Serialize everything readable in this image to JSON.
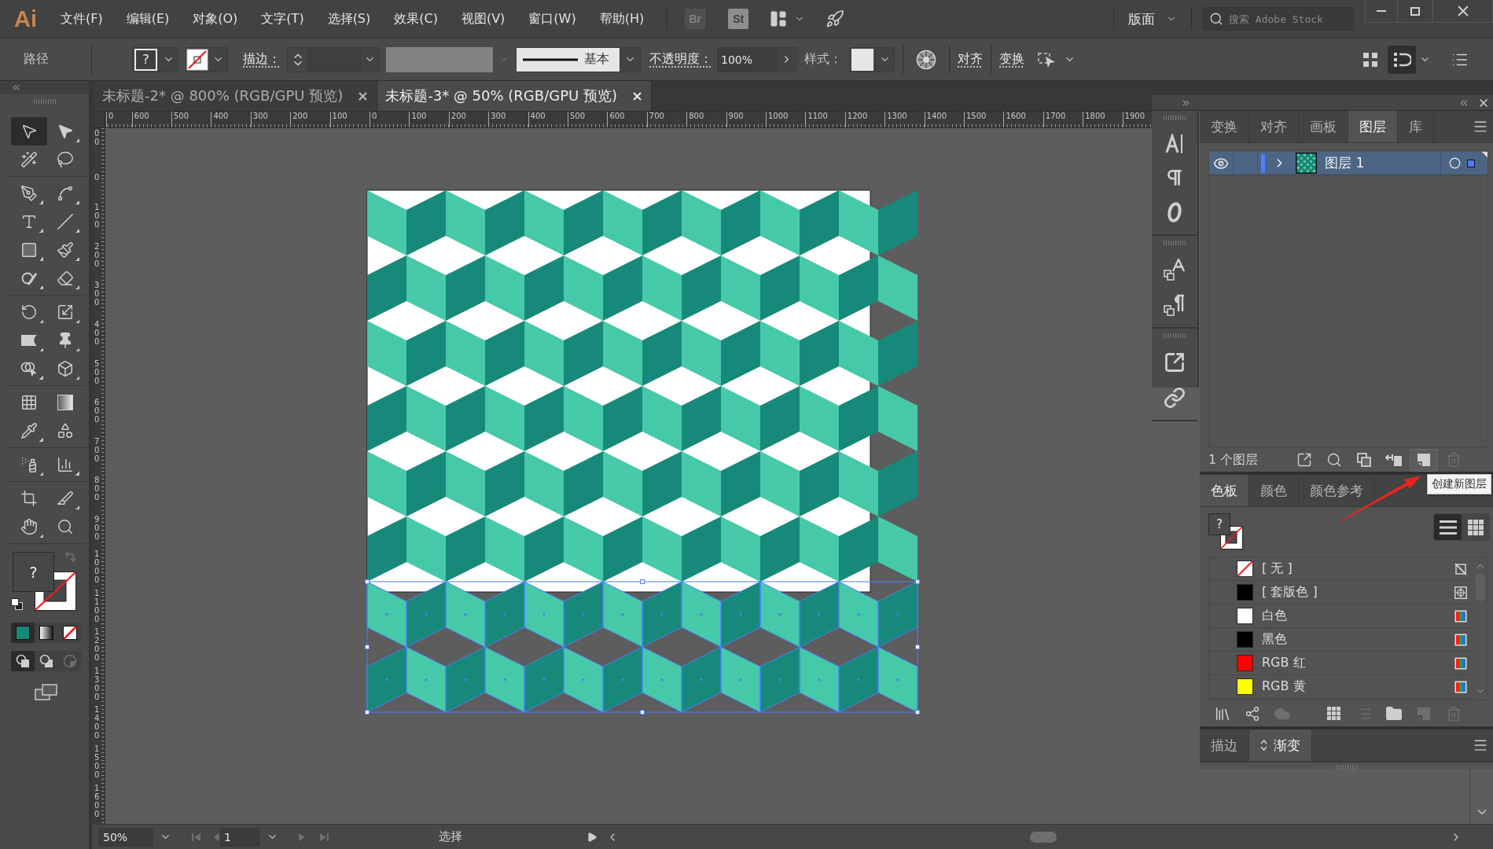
{
  "menu_bar": {
    "logo": "Ai",
    "items": [
      "文件(F)",
      "编辑(E)",
      "对象(O)",
      "文字(T)",
      "选择(S)",
      "效果(C)",
      "视图(V)",
      "窗口(W)",
      "帮助(H)"
    ],
    "bridge": "Br",
    "stock": "St",
    "workspace": "版面",
    "search": {
      "placeholder": "搜索 Adobe Stock"
    }
  },
  "control_bar": {
    "selection": "路径",
    "fill": "?",
    "stroke_label": "描边：",
    "brush": "基本",
    "opacity_label": "不透明度：",
    "opacity": "100%",
    "style_label": "样式：",
    "align": "对齐",
    "transform": "变换"
  },
  "toolbar": {
    "tool_groups": [
      [
        {
          "kind": "selection",
          "selected": true,
          "flyout": false
        },
        {
          "kind": "direct-selection",
          "selected": false,
          "flyout": true
        },
        {
          "kind": "magic-wand",
          "selected": false,
          "flyout": false
        },
        {
          "kind": "lasso",
          "selected": false,
          "flyout": false
        }
      ],
      [
        {
          "kind": "pen",
          "selected": false,
          "flyout": true
        },
        {
          "kind": "curvature",
          "selected": false,
          "flyout": true
        },
        {
          "kind": "type",
          "selected": false,
          "flyout": true
        },
        {
          "kind": "line",
          "selected": false,
          "flyout": true
        },
        {
          "kind": "rectangle",
          "selected": false,
          "flyout": true
        },
        {
          "kind": "paintbrush",
          "selected": false,
          "flyout": true
        },
        {
          "kind": "shaper",
          "selected": false,
          "flyout": true
        },
        {
          "kind": "eraser",
          "selected": false,
          "flyout": true
        }
      ],
      [
        {
          "kind": "rotate",
          "selected": false,
          "flyout": true
        },
        {
          "kind": "scale",
          "selected": false,
          "flyout": true
        },
        {
          "kind": "width",
          "selected": false,
          "flyout": true
        },
        {
          "kind": "puppet-warp",
          "selected": false,
          "flyout": true
        },
        {
          "kind": "shape-builder",
          "selected": false,
          "flyout": true
        },
        {
          "kind": "perspective",
          "selected": false,
          "flyout": true
        }
      ],
      [
        {
          "kind": "mesh",
          "selected": false,
          "flyout": false
        },
        {
          "kind": "gradient",
          "selected": false,
          "flyout": false
        },
        {
          "kind": "eyedropper",
          "selected": false,
          "flyout": true
        },
        {
          "kind": "blend",
          "selected": false,
          "flyout": false
        }
      ],
      [
        {
          "kind": "symbol-sprayer",
          "selected": false,
          "flyout": true
        },
        {
          "kind": "graph",
          "selected": false,
          "flyout": true
        }
      ],
      [
        {
          "kind": "artboard",
          "selected": false,
          "flyout": false
        },
        {
          "kind": "slice",
          "selected": false,
          "flyout": true
        },
        {
          "kind": "hand",
          "selected": false,
          "flyout": true
        },
        {
          "kind": "zoom",
          "selected": false,
          "flyout": false
        }
      ]
    ],
    "fill": "?",
    "color_modes": [
      {
        "kind": "color",
        "selected": true
      },
      {
        "kind": "gradient",
        "selected": false
      },
      {
        "kind": "none",
        "selected": false
      }
    ],
    "draw_modes": [
      {
        "kind": "normal",
        "selected": true,
        "disabled": false
      },
      {
        "kind": "behind",
        "selected": false,
        "disabled": false
      },
      {
        "kind": "inside",
        "selected": false,
        "disabled": true
      }
    ]
  },
  "document_tabs": [
    {
      "title": "未标题-2* @ 800% (RGB/GPU 预览)",
      "selected": false
    },
    {
      "title": "未标题-3* @ 50% (RGB/GPU 预览)",
      "selected": true
    }
  ],
  "rulers": {
    "horizontal": [
      "0",
      "600",
      "500",
      "400",
      "300",
      "200",
      "100",
      "0",
      "100",
      "200",
      "300",
      "400",
      "500",
      "600",
      "700",
      "800",
      "900",
      "1000",
      "1100",
      "1200",
      "1300",
      "1400",
      "1500",
      "1600",
      "1700",
      "1800",
      "1900"
    ],
    "vertical": [
      "00",
      "0",
      "100",
      "200",
      "300",
      "400",
      "500",
      "600",
      "700",
      "800",
      "900",
      "1000",
      "1100",
      "1200",
      "1300",
      "1400",
      "1500",
      "1600"
    ]
  },
  "layers_panel": {
    "tabs": [
      {
        "label": "变换",
        "selected": false
      },
      {
        "label": "对齐",
        "selected": false
      },
      {
        "label": "画板",
        "selected": false
      },
      {
        "label": "图层",
        "selected": true
      },
      {
        "label": "库",
        "selected": false
      }
    ],
    "layers": [
      {
        "name": "图层 1",
        "visible": true,
        "expanded": false,
        "selected": true,
        "color": "#4f7dff"
      }
    ],
    "count": "1 个图层",
    "footer_buttons": [
      {
        "kind": "export",
        "hovered": false,
        "disabled": false
      },
      {
        "kind": "locate",
        "hovered": false,
        "disabled": false
      },
      {
        "kind": "clipping-mask",
        "hovered": false,
        "disabled": false
      },
      {
        "kind": "move-selection",
        "hovered": false,
        "disabled": false
      },
      {
        "kind": "new-layer",
        "hovered": true,
        "disabled": false
      },
      {
        "kind": "delete",
        "hovered": false,
        "disabled": true
      }
    ]
  },
  "tooltip": "创建新图层",
  "swatches_panel": {
    "tabs": [
      {
        "label": "色板",
        "selected": true
      },
      {
        "label": "颜色",
        "selected": false
      },
      {
        "label": "颜色参考",
        "selected": false
      }
    ],
    "fill": "?",
    "views": [
      {
        "kind": "list",
        "selected": true
      },
      {
        "kind": "grid",
        "selected": false
      }
    ],
    "swatches": [
      {
        "name": "[ 无 ]",
        "kind": "none"
      },
      {
        "name": "[ 套版色 ]",
        "kind": "registration",
        "color": "#000000"
      },
      {
        "name": "白色",
        "kind": "process",
        "color": "#ffffff"
      },
      {
        "name": "黑色",
        "kind": "process",
        "color": "#000000"
      },
      {
        "name": "RGB 红",
        "kind": "process",
        "color": "#ff0000"
      },
      {
        "name": "RGB 黄",
        "kind": "process",
        "color": "#ffff00"
      }
    ],
    "footer_buttons": [
      {
        "kind": "libraries",
        "disabled": false
      },
      {
        "kind": "swatch-kinds",
        "disabled": false
      },
      {
        "kind": "cloud",
        "disabled": true
      },
      {
        "kind": "swatch-options-grid",
        "disabled": false
      },
      {
        "kind": "swatch-options",
        "disabled": true
      },
      {
        "kind": "color-group",
        "disabled": false
      },
      {
        "kind": "new-swatch",
        "disabled": true
      },
      {
        "kind": "delete",
        "disabled": true
      }
    ]
  },
  "stroke_gradient_panel": {
    "tabs": [
      {
        "label": "描边",
        "selected": false
      },
      {
        "label": "渐变",
        "selected": true
      }
    ]
  },
  "status_bar": {
    "zoom": "50%",
    "artboard": "1",
    "artboard_nav": [
      {
        "kind": "first",
        "disabled": true
      },
      {
        "kind": "previous",
        "disabled": true
      },
      {
        "kind": "next",
        "disabled": true
      },
      {
        "kind": "last",
        "disabled": true
      }
    ],
    "status": "选择"
  }
}
